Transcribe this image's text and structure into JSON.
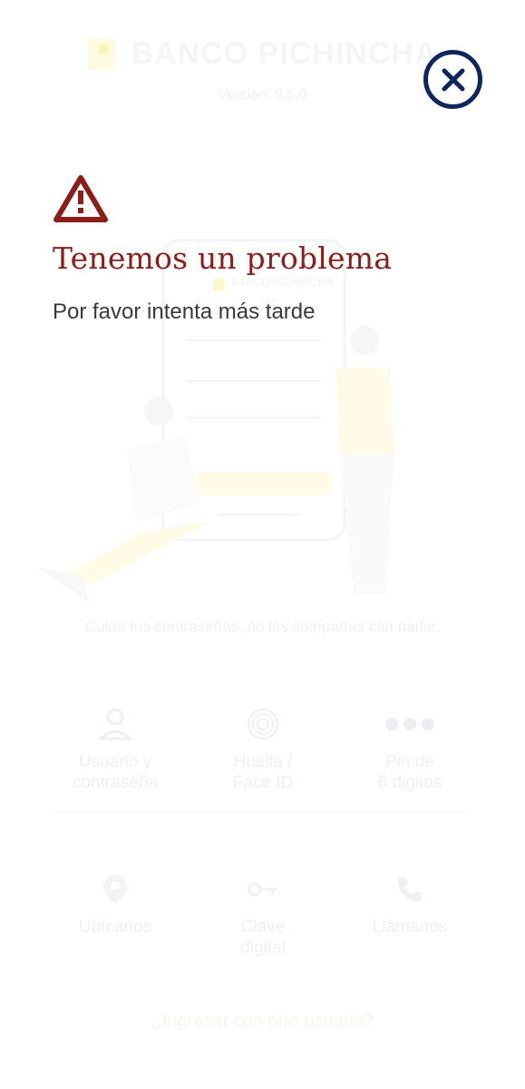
{
  "app": {
    "brand_name": "BANCO PICHINCHA",
    "version": "Versión: 9.5.0",
    "illustration_brand": "BANCO PICHINCHA",
    "tip": "Cuida tus contraseñas, no las compartas con nadie."
  },
  "login_options": [
    {
      "label_line1": "Usuario y",
      "label_line2": "contraseña",
      "icon": "user-icon"
    },
    {
      "label_line1": "Huella /",
      "label_line2": "Face ID",
      "icon": "fingerprint-icon"
    },
    {
      "label_line1": "Pin de",
      "label_line2": "6 digitos",
      "icon": "pin-dots-icon"
    }
  ],
  "secondary_options": [
    {
      "label_line1": "Ubícanos",
      "label_line2": "",
      "icon": "location-pin-icon"
    },
    {
      "label_line1": "Clave",
      "label_line2": "digital",
      "icon": "key-icon"
    },
    {
      "label_line1": "Llámanos",
      "label_line2": "",
      "icon": "phone-icon"
    }
  ],
  "other_user_link": "¿Ingresar con otro usuario?",
  "error": {
    "title": "Tenemos un problema",
    "message": "Por favor intenta más tarde",
    "close_icon": "close-icon",
    "warning_icon": "warning-icon"
  },
  "colors": {
    "error_red": "#8a1f1a",
    "close_navy": "#0f265c",
    "text_gray": "#3a3a3a"
  }
}
